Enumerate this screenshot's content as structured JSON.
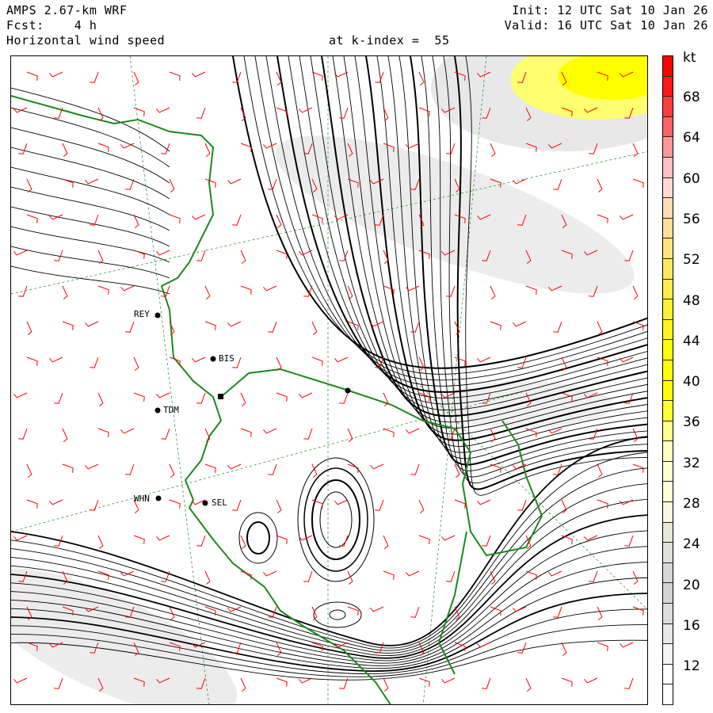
{
  "header": {
    "model": "AMPS 2.67-km WRF",
    "forecast": "Fcst:    4 h",
    "field": "Horizontal wind speed",
    "level": "at k-index =  55",
    "init": "Init: 12 UTC Sat 10 Jan 26",
    "valid": "Valid: 16 UTC Sat 10 Jan 26"
  },
  "colorbar": {
    "unit": "kt",
    "labels": [
      "68",
      "64",
      "60",
      "56",
      "52",
      "48",
      "44",
      "40",
      "36",
      "32",
      "28",
      "24",
      "20",
      "16",
      "12"
    ],
    "colors": [
      "#ff0000",
      "#ff1a1a",
      "#ff3c3c",
      "#ff6464",
      "#ff9898",
      "#ffc2c2",
      "#ffdad0",
      "#ffdcb4",
      "#ffe096",
      "#ffe47c",
      "#ffe860",
      "#ffec48",
      "#fff030",
      "#fff41c",
      "#ffff00",
      "#ffff00",
      "#ffff00",
      "#ffff30",
      "#ffff90",
      "#ffffc4",
      "#ffffd2",
      "#ffffd8",
      "#f8f8e0",
      "#e8e8d6",
      "#e0e0dc",
      "#d6d6d6",
      "#d4d4d4",
      "#dcdcdc",
      "#e8e8e8",
      "#f4f4f4",
      "#ffffff",
      "#ffffff"
    ]
  },
  "stations": [
    {
      "id": "REY"
    },
    {
      "id": "BIS"
    },
    {
      "id": "TDM"
    },
    {
      "id": "WHN"
    },
    {
      "id": "SEL"
    }
  ],
  "colors": {
    "coast": "#1a8a1a",
    "barb": "#ff0000",
    "stream": "#000000",
    "grid": "#1a8a1a"
  }
}
